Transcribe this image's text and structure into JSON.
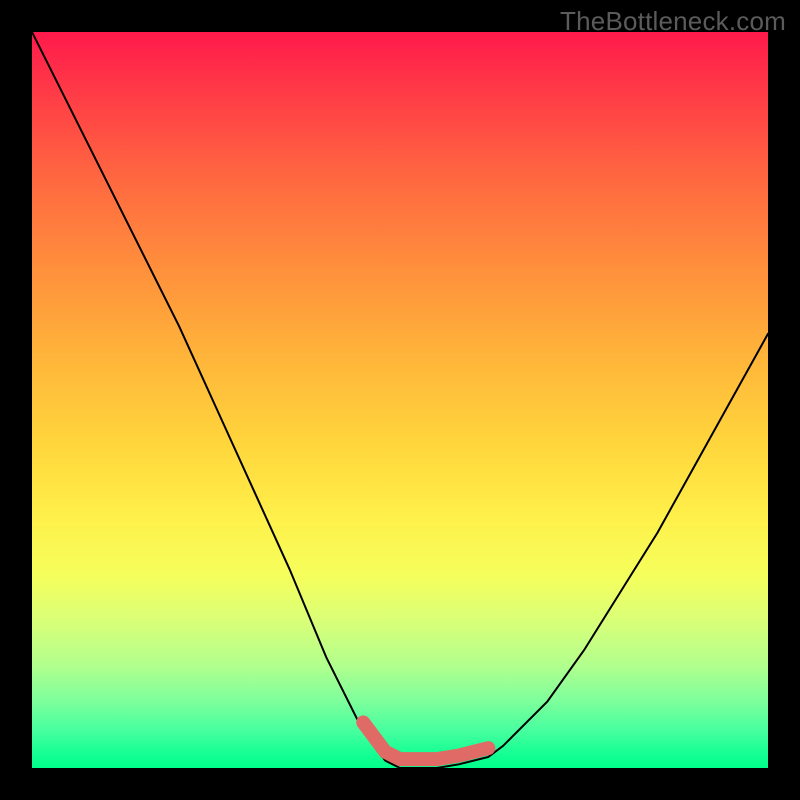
{
  "watermark": "TheBottleneck.com",
  "chart_data": {
    "type": "line",
    "title": "",
    "xlabel": "",
    "ylabel": "",
    "xlim": [
      0,
      100
    ],
    "ylim": [
      0,
      100
    ],
    "series": [
      {
        "name": "curve",
        "x": [
          0,
          5,
          10,
          15,
          20,
          25,
          30,
          35,
          40,
          45,
          48,
          50,
          52,
          55,
          58,
          60,
          62,
          64,
          70,
          75,
          80,
          85,
          90,
          95,
          100
        ],
        "y": [
          100,
          90,
          80,
          70,
          60,
          49,
          38,
          27,
          15,
          5,
          1,
          0,
          0,
          0,
          0.5,
          1,
          1.5,
          3,
          9,
          16,
          24,
          32,
          41,
          50,
          59
        ]
      }
    ],
    "marker_band": {
      "name": "accent-band",
      "color": "#e06a65",
      "x_range": [
        45,
        62
      ],
      "y": 0
    }
  }
}
